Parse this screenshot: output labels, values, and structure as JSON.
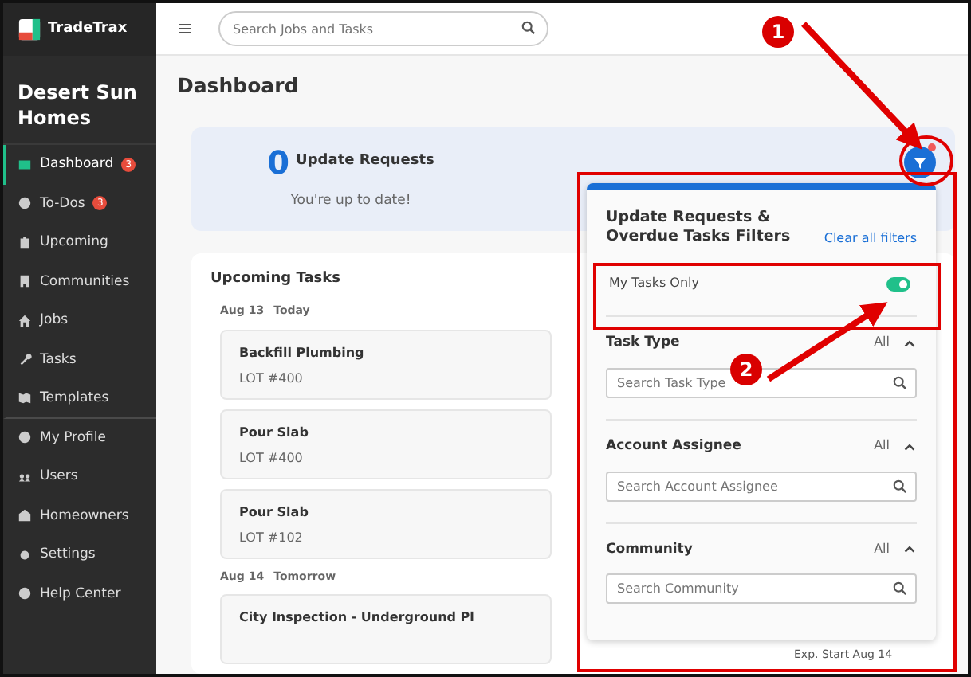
{
  "app": {
    "logo_text": "TradeTrax",
    "company": "Desert Sun Homes"
  },
  "sidebar": {
    "items": [
      {
        "label": "Dashboard",
        "badge": "3",
        "selected": true,
        "divider_after": false
      },
      {
        "label": "To-Dos",
        "badge": "3",
        "selected": false,
        "divider_after": false
      },
      {
        "label": "Upcoming",
        "selected": false,
        "divider_after": false
      },
      {
        "label": "Communities",
        "selected": false,
        "divider_after": false
      },
      {
        "label": "Jobs",
        "selected": false,
        "divider_after": false
      },
      {
        "label": "Tasks",
        "selected": false,
        "divider_after": false
      },
      {
        "label": "Templates",
        "selected": false,
        "divider_after": true
      },
      {
        "label": "My Profile",
        "selected": false,
        "divider_after": false
      },
      {
        "label": "Users",
        "selected": false,
        "divider_after": false
      },
      {
        "label": "Homeowners",
        "selected": false,
        "divider_after": false
      },
      {
        "label": "Settings",
        "selected": false,
        "divider_after": false
      },
      {
        "label": "Help Center",
        "selected": false,
        "divider_after": false
      }
    ]
  },
  "topbar": {
    "search": {
      "placeholder": "Search Jobs and Tasks"
    }
  },
  "page_title": "Dashboard",
  "update_requests": {
    "count": "0",
    "label": "Update Requests",
    "message": "You're up to date!",
    "filter_active": true
  },
  "upcoming": {
    "title": "Upcoming Tasks",
    "groups": [
      {
        "date": "Aug 13",
        "day": "Today",
        "tasks": [
          {
            "name": "Backfill Plumbing",
            "lot": "LOT #400"
          },
          {
            "name": "Pour Slab",
            "lot": "LOT #400"
          },
          {
            "name": "Pour Slab",
            "lot": "LOT #102"
          }
        ]
      },
      {
        "date": "Aug 14",
        "day": "Tomorrow",
        "tasks": [
          {
            "name": "City Inspection - Underground Pl"
          }
        ]
      }
    ],
    "side_note": "Exp. Start Aug 14"
  },
  "filter_popup": {
    "title": "Update Requests & Overdue Tasks Filters",
    "clear_link": "Clear all filters",
    "my_tasks_only": {
      "label": "My Tasks Only",
      "on": true
    },
    "sections": [
      {
        "title": "Task Type",
        "value": "All",
        "expanded": true,
        "placeholder": "Search Task Type"
      },
      {
        "title": "Account Assignee",
        "value": "All",
        "expanded": true,
        "placeholder": "Search Account Assignee"
      },
      {
        "title": "Community",
        "value": "All",
        "expanded": true,
        "placeholder": "Search Community"
      }
    ]
  },
  "annotations": [
    {
      "number": "1"
    },
    {
      "number": "2"
    }
  ]
}
